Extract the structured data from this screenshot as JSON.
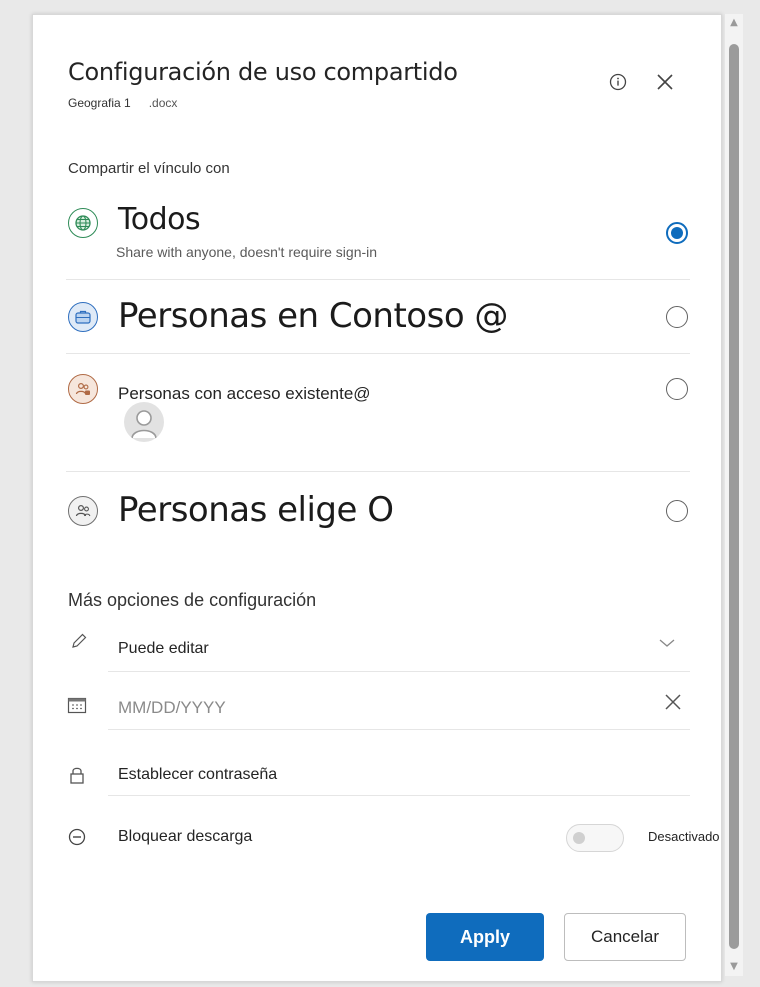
{
  "dialog": {
    "title": "Configuración de uso compartido",
    "file_name": "Geografia 1",
    "file_ext": ".docx"
  },
  "share_section": {
    "label": "Compartir el vínculo con",
    "options": [
      {
        "title": "Todos",
        "subtitle": "Share with anyone, doesn't require sign-in",
        "icon": "globe-icon",
        "selected": true
      },
      {
        "title": "Personas en Contoso @",
        "icon": "briefcase-icon",
        "selected": false
      },
      {
        "title": "Personas con acceso existente@",
        "icon": "people-icon",
        "selected": false
      },
      {
        "title": "Personas elige O",
        "icon": "people-icon",
        "selected": false
      }
    ]
  },
  "more_settings": {
    "label": "Más opciones de configuración",
    "permission": {
      "value": "Puede editar",
      "icon": "pencil-icon"
    },
    "date": {
      "placeholder": "MM/DD/YYYY",
      "icon": "calendar-icon"
    },
    "password": {
      "label": "Establecer contraseña",
      "icon": "lock-icon"
    },
    "block_download": {
      "label": "Bloquear descarga",
      "state_label": "Desactivado",
      "on": false,
      "icon": "block-icon"
    }
  },
  "buttons": {
    "apply": "Apply",
    "cancel": "Cancelar"
  },
  "colors": {
    "accent": "#0f6cbd",
    "globe": "#2e8b57",
    "briefcase": "#2f6fbf",
    "people_existing": "#b06a45",
    "people": "#707070"
  }
}
